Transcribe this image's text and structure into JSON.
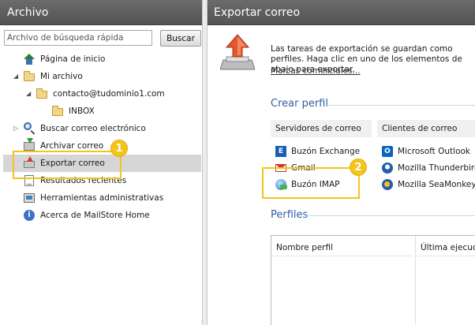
{
  "left_pane": {
    "title": "Archivo",
    "search": {
      "placeholder": "Archivo de búsqueda rápida",
      "button_label": "Buscar"
    },
    "tree": [
      {
        "label": "Página de inicio",
        "icon": "home-icon"
      },
      {
        "label": "Mi archivo",
        "icon": "folder-icon",
        "expanded": true
      },
      {
        "label": "contacto@tudominio1.com",
        "icon": "folder-icon",
        "expanded": true
      },
      {
        "label": "INBOX",
        "icon": "folder-icon"
      },
      {
        "label": "Buscar correo electrónico",
        "icon": "search-icon",
        "expanded": false
      },
      {
        "label": "Archivar correo",
        "icon": "archive-icon"
      },
      {
        "label": "Exportar correo",
        "icon": "export-icon",
        "selected": true
      },
      {
        "label": "Resultados recientes",
        "icon": "results-icon"
      },
      {
        "label": "Herramientas administrativas",
        "icon": "tools-icon"
      },
      {
        "label": "Acerca de MailStore Home",
        "icon": "about-icon"
      }
    ]
  },
  "right_pane": {
    "title": "Exportar correo",
    "intro": "Las tareas de exportación se guardan como perfiles. Haga clic en uno de los elementos de abajo para exportar.",
    "trademarks_link": "Marcas comerciales...",
    "create_profile": {
      "title": "Crear perfil",
      "mail_servers": {
        "header": "Servidores de correo",
        "items": [
          {
            "label": "Buzón Exchange",
            "icon": "exchange-icon"
          },
          {
            "label": "Gmail",
            "icon": "gmail-icon"
          },
          {
            "label": "Buzón IMAP",
            "icon": "imap-icon"
          }
        ]
      },
      "mail_clients": {
        "header": "Clientes de correo",
        "items": [
          {
            "label": "Microsoft Outlook",
            "icon": "outlook-icon"
          },
          {
            "label": "Mozilla Thunderbird",
            "icon": "thunderbird-icon"
          },
          {
            "label": "Mozilla SeaMonkey",
            "icon": "seamonkey-icon"
          }
        ]
      }
    },
    "profiles": {
      "title": "Perfiles",
      "columns": [
        "Nombre perfil",
        "Última ejecución"
      ]
    }
  },
  "callouts": [
    "1",
    "2"
  ],
  "colors": {
    "header_bg": "#5f5f5f",
    "section_title": "#2f5f9e",
    "callout": "#f3c41a",
    "selection": "#d6d6d6"
  }
}
